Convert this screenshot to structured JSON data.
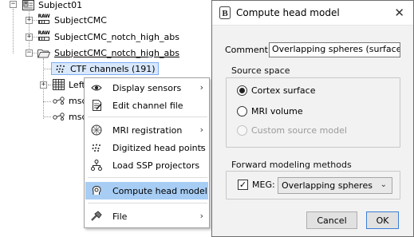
{
  "tree": {
    "root": {
      "label": "Subject01",
      "expander": "−"
    },
    "items": [
      {
        "label": "SubjectCMC",
        "expander": "+",
        "raw_text": "RAW"
      },
      {
        "label": "SubjectCMC_notch_high_abs",
        "expander": "+",
        "raw_text": "RAW"
      },
      {
        "label": "SubjectCMC_notch_high_abs",
        "expander": "−"
      },
      {
        "label": "CTF channels (191)"
      },
      {
        "label": "Left",
        "expander": "+"
      },
      {
        "label": "msc"
      },
      {
        "label": "msc"
      }
    ]
  },
  "context_menu": {
    "items": [
      {
        "label": "Display sensors",
        "icon": "eye-icon",
        "has_submenu": true
      },
      {
        "label": "Edit channel file",
        "icon": "edit-document-icon",
        "has_submenu": false
      },
      {
        "label": "MRI registration",
        "icon": "head-mesh-icon",
        "has_submenu": true
      },
      {
        "label": "Digitized head points",
        "icon": "dots-icon",
        "has_submenu": true
      },
      {
        "label": "Load SSP projectors",
        "icon": "tree-network-icon",
        "has_submenu": false
      },
      {
        "label": "Compute head model",
        "icon": "head-model-icon",
        "has_submenu": false,
        "highlighted": true
      },
      {
        "label": "File",
        "icon": "hammer-icon",
        "has_submenu": true
      }
    ],
    "submenu_arrow": "›"
  },
  "dialog": {
    "title": "Compute head model",
    "app_icon_text": "B",
    "close_glyph": "✕",
    "comment_label": "Comment:",
    "comment_value": "Overlapping spheres (surface)",
    "source_space": {
      "title": "Source space",
      "options": [
        {
          "label": "Cortex surface",
          "selected": true,
          "enabled": true
        },
        {
          "label": "MRI volume",
          "selected": false,
          "enabled": true
        },
        {
          "label": "Custom source model",
          "selected": false,
          "enabled": false
        }
      ]
    },
    "forward": {
      "title": "Forward modeling methods",
      "meg_checked": true,
      "meg_label": "MEG:",
      "meg_method": "Overlapping spheres",
      "check_glyph": "✓",
      "dropdown_glyph": "⌄"
    },
    "cancel_label": "Cancel",
    "ok_label": "OK"
  },
  "colors": {
    "menu_highlight": "#a7cdf4",
    "selection": "#d9e8fb",
    "dialog_bg": "#f2f2f2",
    "default_button_border": "#3c7fd6"
  }
}
